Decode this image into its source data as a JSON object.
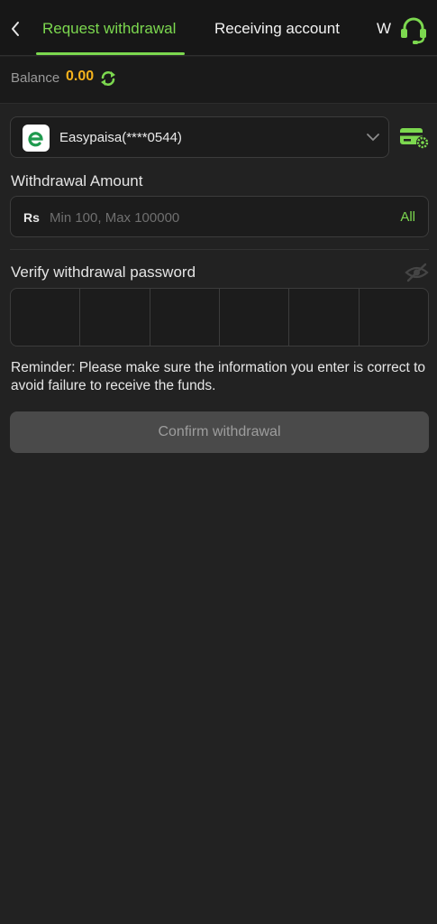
{
  "header": {
    "tabs": [
      {
        "label": "Request withdrawal",
        "active": true
      },
      {
        "label": "Receiving account",
        "active": false
      },
      {
        "label": "W",
        "active": false
      }
    ]
  },
  "balance": {
    "label": "Balance",
    "value": "0.00"
  },
  "account": {
    "name": "Easypaisa(****0544)",
    "logo_letter": "e"
  },
  "amount": {
    "label": "Withdrawal Amount",
    "currency": "Rs",
    "placeholder": "Min 100, Max 100000",
    "value": "",
    "all_label": "All"
  },
  "password": {
    "label": "Verify withdrawal password",
    "digits": [
      "",
      "",
      "",
      "",
      "",
      ""
    ]
  },
  "reminder": "Reminder: Please make sure the information you enter is correct to avoid failure to receive the funds.",
  "confirm_label": "Confirm withdrawal",
  "colors": {
    "accent": "#7cd84f",
    "balance": "#f5b21c",
    "background": "#222222",
    "button_disabled": "#4a4a4a"
  }
}
